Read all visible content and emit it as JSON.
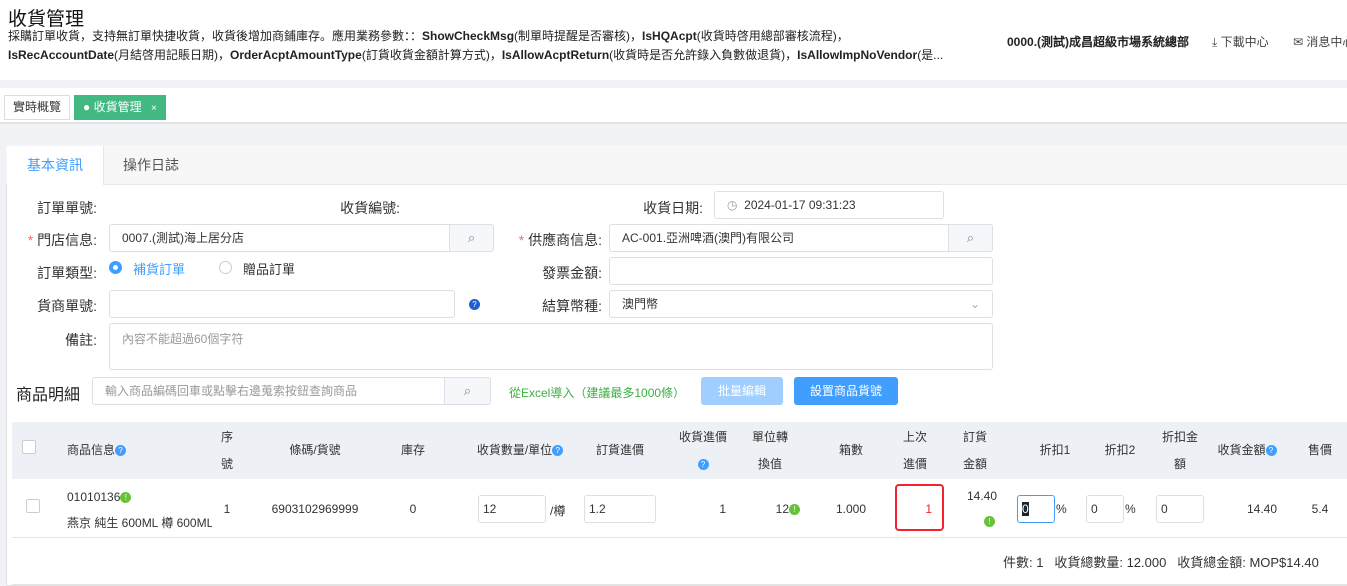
{
  "header": {
    "title": "收貨管理",
    "desc_line1": [
      {
        "t": "採購訂單收貨，支持無訂單快捷收貨，收貨後增加商鋪庫存。應用業務參數：："
      },
      {
        "b": "ShowCheckMsg"
      },
      {
        "t": "(制單時提醒是否審核)，"
      },
      {
        "b": "IsHQAcpt"
      },
      {
        "t": "(收貨時啓用總部審核流程)，"
      }
    ],
    "desc_line2": [
      {
        "b": "IsRecAccountDate"
      },
      {
        "t": "(月結啓用記賬日期)，"
      },
      {
        "b": "OrderAcptAmountType"
      },
      {
        "t": "(訂貨收貨金額計算方式)，"
      },
      {
        "b": "IsAllowAcptReturn"
      },
      {
        "t": "(收貨時是否允許錄入負數做退貨)，"
      },
      {
        "b": "IsAllowImpNoVendor"
      },
      {
        "t": "(是..."
      }
    ],
    "org": "0000.(測試)成昌超級市場系統總部",
    "download": "下載中心",
    "messages": "消息中心"
  },
  "page_tabs": [
    {
      "label": "實時概覽"
    },
    {
      "label": "收貨管理",
      "close": "×"
    }
  ],
  "content_tabs": [
    "基本資訊",
    "操作日誌"
  ],
  "form": {
    "order_no_label": "訂單單號:",
    "receipt_no_label": "收貨編號:",
    "date_label": "收貨日期:",
    "date_value": "2024-01-17 09:31:23",
    "store_label": "門店信息:",
    "store_value": "0007.(測試)海上居分店",
    "vendor_label": "供應商信息:",
    "vendor_value": "AC-001.亞洲啤酒(澳門)有限公司",
    "order_type_label": "訂單類型:",
    "order_type_options": [
      "補貨訂單",
      "贈品訂單"
    ],
    "order_type_selected": "補貨訂單",
    "invoice_label": "發票金額:",
    "invoice_value": "",
    "vendor_order_label": "貨商單號:",
    "vendor_order_value": "",
    "currency_label": "結算幣種:",
    "currency_value": "澳門幣",
    "remark_label": "備註:",
    "remark_placeholder": "內容不能超過60個字符"
  },
  "products": {
    "title": "商品明細",
    "search_placeholder": "輸入商品編碼回車或點擊右邊蒐索按鈕查詢商品",
    "import_link": "從Excel導入（建議最多1000條）",
    "batch_edit": "批量編輯",
    "set_code": "設置商品貨號",
    "columns": [
      "商品信息",
      "序號",
      "條碼/貨號",
      "庫存",
      "收貨數量/單位",
      "訂貨進價",
      "收貨進價",
      "單位轉換值",
      "箱數",
      "上次進價",
      "訂貨金額",
      "折扣1",
      "折扣2",
      "折扣金額",
      "收貨金額",
      "售價"
    ],
    "rows": [
      {
        "code": "01010136",
        "name": "燕京 純生 600ML 樽 600ML",
        "seq": "1",
        "barcode": "6903102969999",
        "stock": "0",
        "qty": "12",
        "unit": "/樽",
        "order_price": "1.2",
        "recv_price": "1",
        "conversion": "12",
        "boxes": "1.000",
        "last_price": "1",
        "order_amount": "14.40",
        "disc1": "0",
        "disc2": "0",
        "disc_amount": "0",
        "recv_amount": "14.40",
        "sale_price": "5.4"
      }
    ],
    "summary": {
      "count_label": "件數:",
      "count": "1",
      "qty_label": "收貨總數量:",
      "qty": "12.000",
      "amount_label": "收貨總金額:",
      "amount": "MOP$14.40"
    }
  },
  "colors": {
    "accent": "#409eff",
    "green": "#42b983",
    "highlight": "#f5222d"
  }
}
